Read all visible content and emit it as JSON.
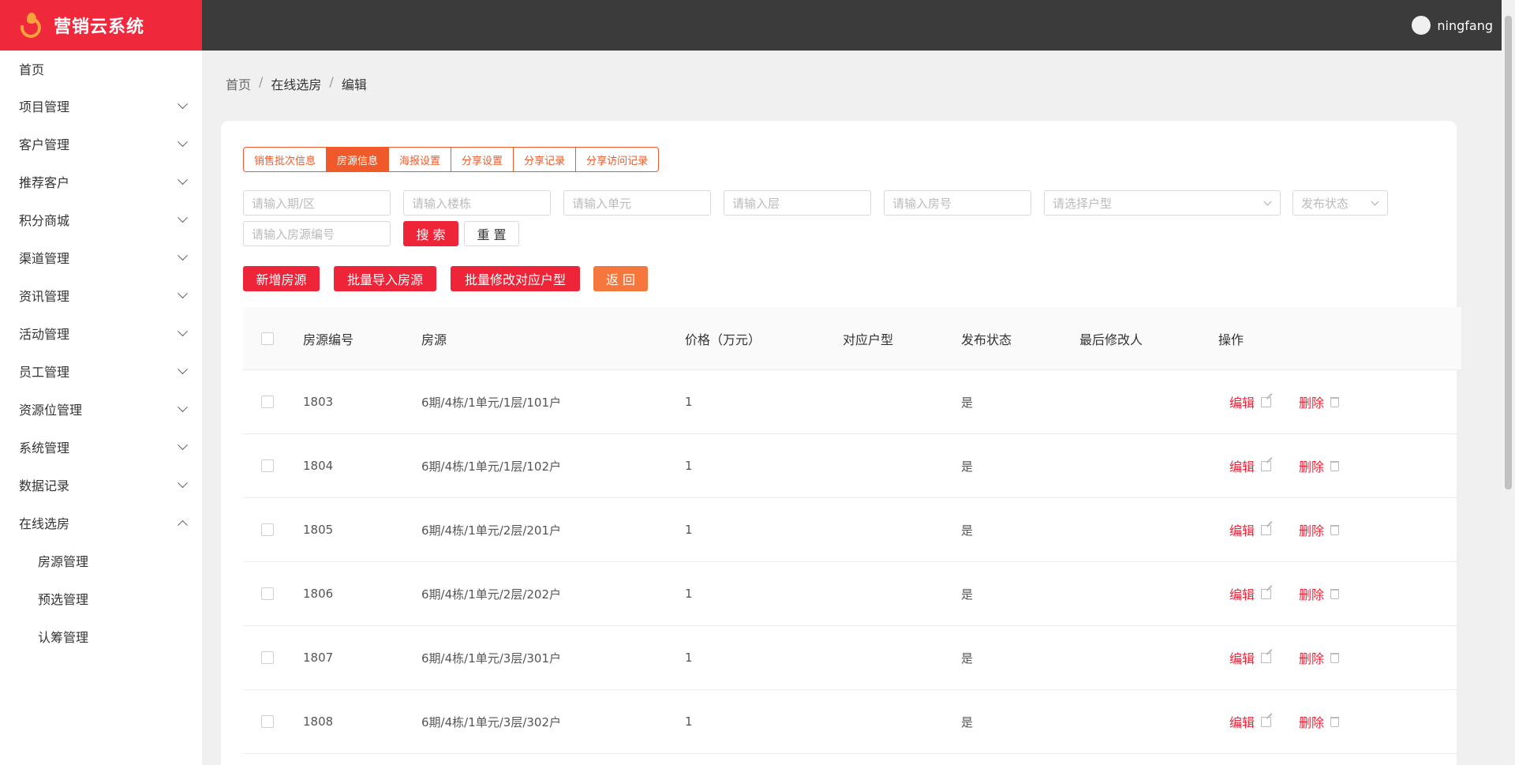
{
  "app": {
    "title": "营销云系统",
    "user": "ningfang"
  },
  "sidebar": {
    "items": [
      {
        "label": "首页"
      },
      {
        "label": "项目管理"
      },
      {
        "label": "客户管理"
      },
      {
        "label": "推荐客户"
      },
      {
        "label": "积分商城"
      },
      {
        "label": "渠道管理"
      },
      {
        "label": "资讯管理"
      },
      {
        "label": "活动管理"
      },
      {
        "label": "员工管理"
      },
      {
        "label": "资源位管理"
      },
      {
        "label": "系统管理"
      },
      {
        "label": "数据记录"
      },
      {
        "label": "在线选房"
      }
    ],
    "sub_items": [
      {
        "label": "房源管理"
      },
      {
        "label": "预选管理"
      },
      {
        "label": "认筹管理"
      }
    ]
  },
  "breadcrumb": {
    "home": "首页",
    "section": "在线选房",
    "current": "编辑",
    "sep": "/"
  },
  "tabs": [
    {
      "label": "销售批次信息"
    },
    {
      "label": "房源信息",
      "active": true
    },
    {
      "label": "海报设置"
    },
    {
      "label": "分享设置"
    },
    {
      "label": "分享记录"
    },
    {
      "label": "分享访问记录"
    }
  ],
  "filters": {
    "period_placeholder": "请输入期/区",
    "building_placeholder": "请输入楼栋",
    "unit_placeholder": "请输入单元",
    "floor_placeholder": "请输入层",
    "room_placeholder": "请输入房号",
    "layout_placeholder": "请选择户型",
    "status_placeholder": "发布状态",
    "code_placeholder": "请输入房源编号",
    "search_label": "搜 索",
    "reset_label": "重 置"
  },
  "actions": {
    "add_label": "新增房源",
    "import_label": "批量导入房源",
    "batch_layout_label": "批量修改对应户型",
    "back_label": "返 回"
  },
  "table": {
    "headers": {
      "code": "房源编号",
      "room": "房源",
      "price": "价格（万元）",
      "layout": "对应户型",
      "status": "发布状态",
      "modifier": "最后修改人",
      "ops": "操作"
    },
    "edit_label": "编辑",
    "delete_label": "删除",
    "rows": [
      {
        "code": "1803",
        "room": "6期/4栋/1单元/1层/101户",
        "price": "1",
        "layout": "",
        "status": "是",
        "modifier": ""
      },
      {
        "code": "1804",
        "room": "6期/4栋/1单元/1层/102户",
        "price": "1",
        "layout": "",
        "status": "是",
        "modifier": ""
      },
      {
        "code": "1805",
        "room": "6期/4栋/1单元/2层/201户",
        "price": "1",
        "layout": "",
        "status": "是",
        "modifier": ""
      },
      {
        "code": "1806",
        "room": "6期/4栋/1单元/2层/202户",
        "price": "1",
        "layout": "",
        "status": "是",
        "modifier": ""
      },
      {
        "code": "1807",
        "room": "6期/4栋/1单元/3层/301户",
        "price": "1",
        "layout": "",
        "status": "是",
        "modifier": ""
      },
      {
        "code": "1808",
        "room": "6期/4栋/1单元/3层/302户",
        "price": "1",
        "layout": "",
        "status": "是",
        "modifier": ""
      }
    ]
  },
  "colors": {
    "brand_red": "#f0283c",
    "accent_orange": "#f0592a",
    "topbar": "#3b3b3b"
  }
}
